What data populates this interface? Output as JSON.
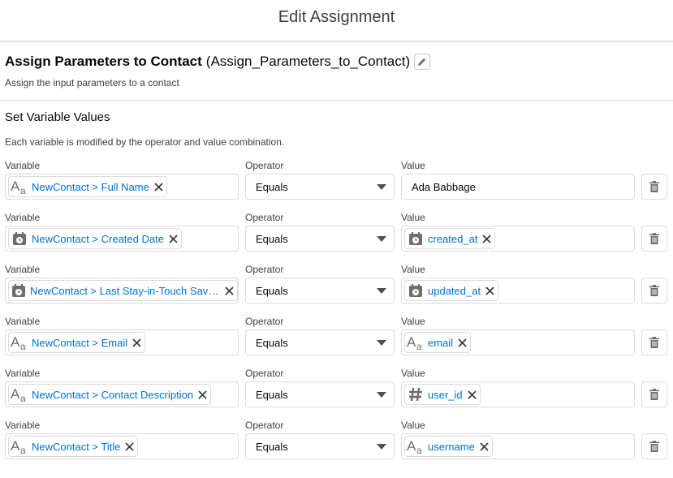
{
  "header": {
    "title": "Edit Assignment"
  },
  "element": {
    "label": "Assign Parameters to Contact",
    "api_name": "(Assign_Parameters_to_Contact)",
    "description": "Assign the input parameters to a contact"
  },
  "variables_section": {
    "title": "Set Variable Values",
    "description": "Each variable is modified by the operator and value combination.",
    "rows": [
      {
        "variable_label": "Variable",
        "operator_label": "Operator",
        "value_label": "Value",
        "variable": "NewContact > Full Name",
        "variable_icon": "text-icon",
        "operator": "Equals",
        "value_type": "text",
        "value": "Ada Babbage",
        "value_icon": ""
      },
      {
        "variable_label": "Variable",
        "operator_label": "Operator",
        "value_label": "Value",
        "variable": "NewContact > Created Date",
        "variable_icon": "datetime-icon",
        "operator": "Equals",
        "value_type": "pill",
        "value": "created_at",
        "value_icon": "datetime-icon"
      },
      {
        "variable_label": "Variable",
        "operator_label": "Operator",
        "value_label": "Value",
        "variable": "NewContact > Last Stay-in-Touch Save Date",
        "variable_icon": "datetime-icon",
        "operator": "Equals",
        "value_type": "pill",
        "value": "updated_at",
        "value_icon": "datetime-icon"
      },
      {
        "variable_label": "Variable",
        "operator_label": "Operator",
        "value_label": "Value",
        "variable": "NewContact > Email",
        "variable_icon": "text-icon",
        "operator": "Equals",
        "value_type": "pill",
        "value": "email",
        "value_icon": "text-icon"
      },
      {
        "variable_label": "Variable",
        "operator_label": "Operator",
        "value_label": "Value",
        "variable": "NewContact > Contact Description",
        "variable_icon": "text-icon",
        "operator": "Equals",
        "value_type": "pill",
        "value": "user_id",
        "value_icon": "number-icon"
      },
      {
        "variable_label": "Variable",
        "operator_label": "Operator",
        "value_label": "Value",
        "variable": "NewContact > Title",
        "variable_icon": "text-icon",
        "operator": "Equals",
        "value_type": "pill",
        "value": "username",
        "value_icon": "text-icon"
      }
    ]
  },
  "colors": {
    "link": "#0070d2",
    "border": "#dddbda",
    "icon": "#706e6b"
  }
}
